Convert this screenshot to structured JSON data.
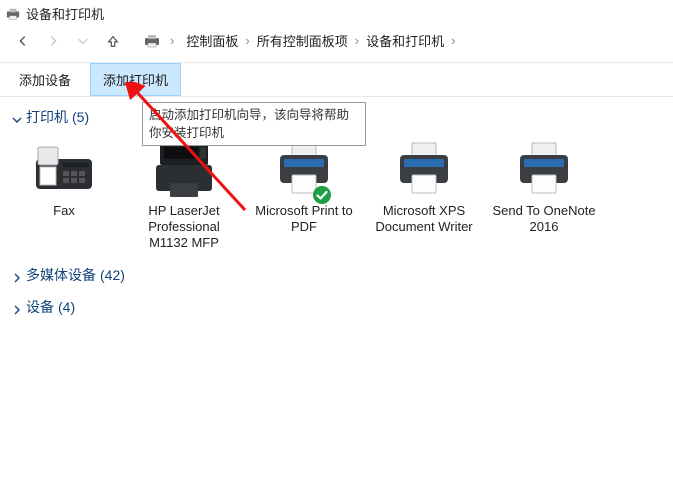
{
  "title": "设备和打印机",
  "breadcrumb": {
    "items": [
      "控制面板",
      "所有控制面板项",
      "设备和打印机"
    ]
  },
  "toolbar": {
    "add_device": "添加设备",
    "add_printer": "添加打印机"
  },
  "tooltip": "启动添加打印机向导，该向导将帮助你安装打印机",
  "groups": {
    "printers": {
      "label": "打印机",
      "count": "(5)"
    },
    "multimedia": {
      "label": "多媒体设备",
      "count": "(42)"
    },
    "devices": {
      "label": "设备",
      "count": "(4)"
    }
  },
  "printers": [
    {
      "label": "Fax"
    },
    {
      "label": "HP LaserJet Professional M1132 MFP"
    },
    {
      "label": "Microsoft Print to PDF"
    },
    {
      "label": "Microsoft XPS Document Writer"
    },
    {
      "label": "Send To OneNote 2016"
    }
  ]
}
